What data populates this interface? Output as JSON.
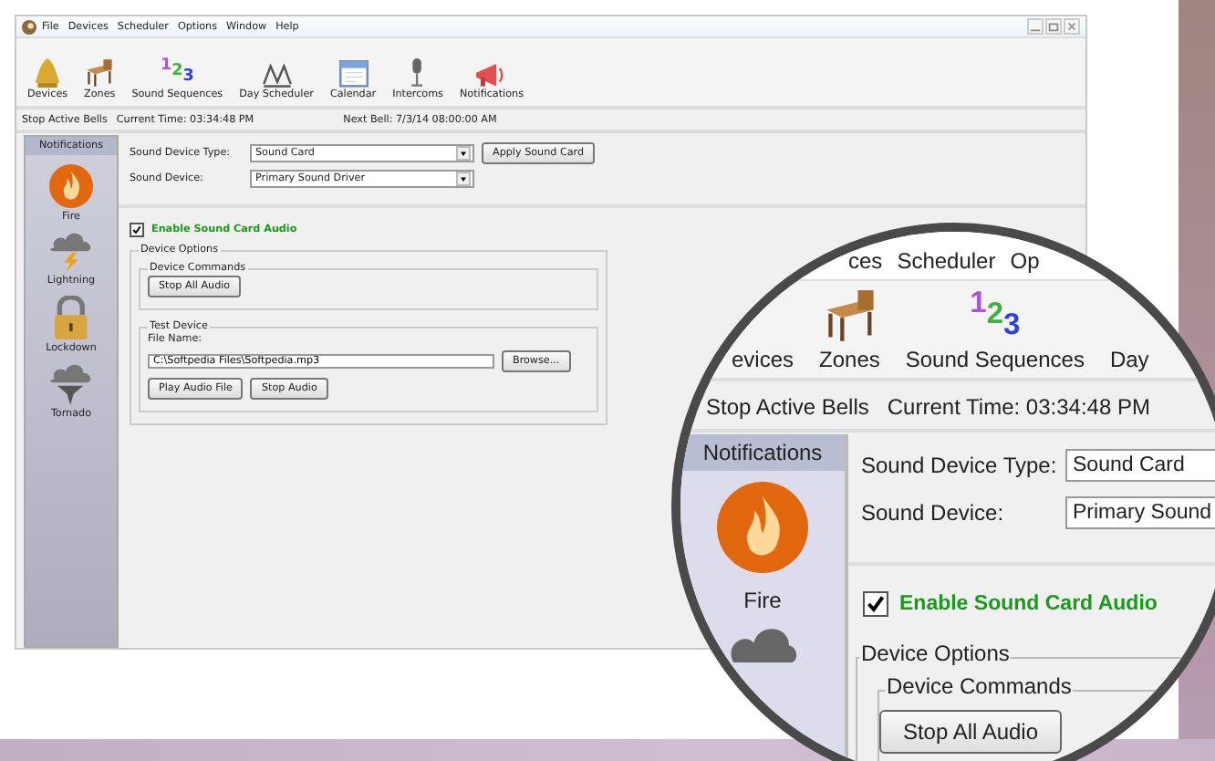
{
  "window": {
    "menu": [
      "File",
      "Devices",
      "Scheduler",
      "Options",
      "Window",
      "Help"
    ],
    "toolbar": [
      {
        "label": "Devices"
      },
      {
        "label": "Zones"
      },
      {
        "label": "Sound Sequences",
        "glyphs": [
          "1",
          "2",
          "3"
        ]
      },
      {
        "label": "Day Scheduler"
      },
      {
        "label": "Calendar"
      },
      {
        "label": "Intercoms"
      },
      {
        "label": "Notifications"
      }
    ],
    "status": {
      "stop": "Stop Active Bells",
      "current_time": "Current Time: 03:34:48 PM",
      "next_bell": "Next Bell: 7/3/14 08:00:00 AM"
    },
    "sidebar": {
      "title": "Notifications",
      "items": [
        {
          "label": "Fire"
        },
        {
          "label": "Lightning"
        },
        {
          "label": "Lockdown"
        },
        {
          "label": "Tornado"
        }
      ]
    },
    "fields": [
      {
        "label": "Sound Device Type:",
        "value": "Sound Card"
      },
      {
        "label": "Sound Device:",
        "value": "Primary Sound Driver"
      }
    ],
    "apply_button": "Apply Sound Card",
    "enable": {
      "label": "Enable Sound Card Audio",
      "checked": true
    },
    "device_options": {
      "title": "Device Options",
      "commands_title": "Device Commands",
      "stop_all": "Stop All Audio",
      "test_title": "Test Device",
      "file_label": "File Name:",
      "file_value": "C:\\Softpedia Files\\Softpedia.mp3",
      "browse": "Browse...",
      "play": "Play Audio File",
      "stop": "Stop Audio"
    }
  },
  "magnifier": {
    "menu": [
      "ces",
      "Scheduler",
      "Op"
    ],
    "toolbar": [
      {
        "label": "evices"
      },
      {
        "label": "Zones"
      },
      {
        "label": "Sound Sequences",
        "glyphs": [
          "1",
          "2",
          "3"
        ]
      },
      {
        "label": "Day"
      }
    ],
    "stop": "Stop Active Bells",
    "current_time": "Current Time: 03:34:48 PM",
    "sidebar_title": "Notifications",
    "sidebar_items": [
      {
        "label": "Fire"
      }
    ],
    "fields": [
      {
        "label": "Sound Device Type:",
        "value": "Sound Card"
      },
      {
        "label": "Sound Device:",
        "value": "Primary Sound"
      }
    ],
    "enable": {
      "label": "Enable Sound Card Audio",
      "checked": true
    },
    "device_options": "Device Options",
    "device_commands": "Device Commands",
    "stop_all": "Stop All Audio"
  }
}
